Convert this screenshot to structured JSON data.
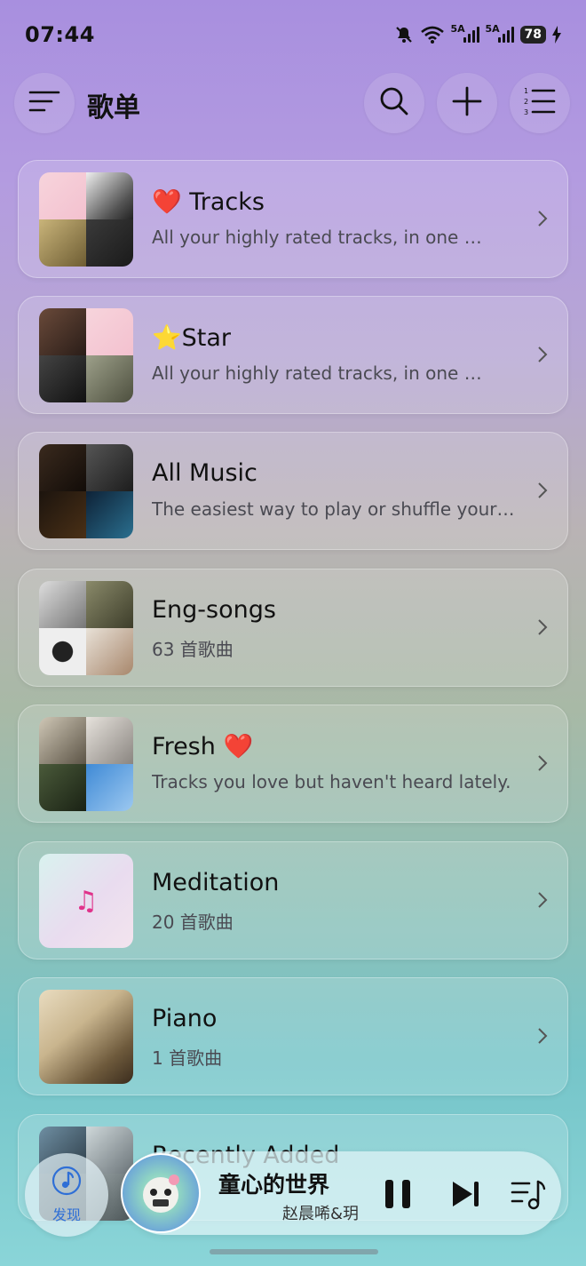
{
  "status_bar": {
    "time": "07:44",
    "sim1_label": "5A",
    "sim2_label": "5A",
    "battery": "78"
  },
  "header": {
    "title": "歌单",
    "icons": [
      "menu-icon",
      "search-icon",
      "plus-icon",
      "numbered-list-icon"
    ]
  },
  "playlists": [
    {
      "title": "❤️ Tracks",
      "subtitle": "All your highly rated tracks, in one …"
    },
    {
      "title": "⭐Star",
      "subtitle": "All your highly rated tracks, in one …"
    },
    {
      "title": "All Music",
      "subtitle": "The easiest way to play or shuffle your…"
    },
    {
      "title": "Eng-songs",
      "subtitle": "63 首歌曲"
    },
    {
      "title": "Fresh ❤️",
      "subtitle": "Tracks you love but haven't heard lately."
    },
    {
      "title": "Meditation",
      "subtitle": "20 首歌曲"
    },
    {
      "title": "Piano",
      "subtitle": "1 首歌曲"
    },
    {
      "title": "Recently Added",
      "subtitle": ""
    }
  ],
  "bottom": {
    "discover_label": "发现",
    "now_playing_title": "童心的世界",
    "now_playing_artist": "赵晨唏&玥"
  },
  "colors": {
    "accent_blue": "#2f6fd6",
    "music_note_pink": "#e0338b",
    "heart_red": "#e0283a"
  }
}
